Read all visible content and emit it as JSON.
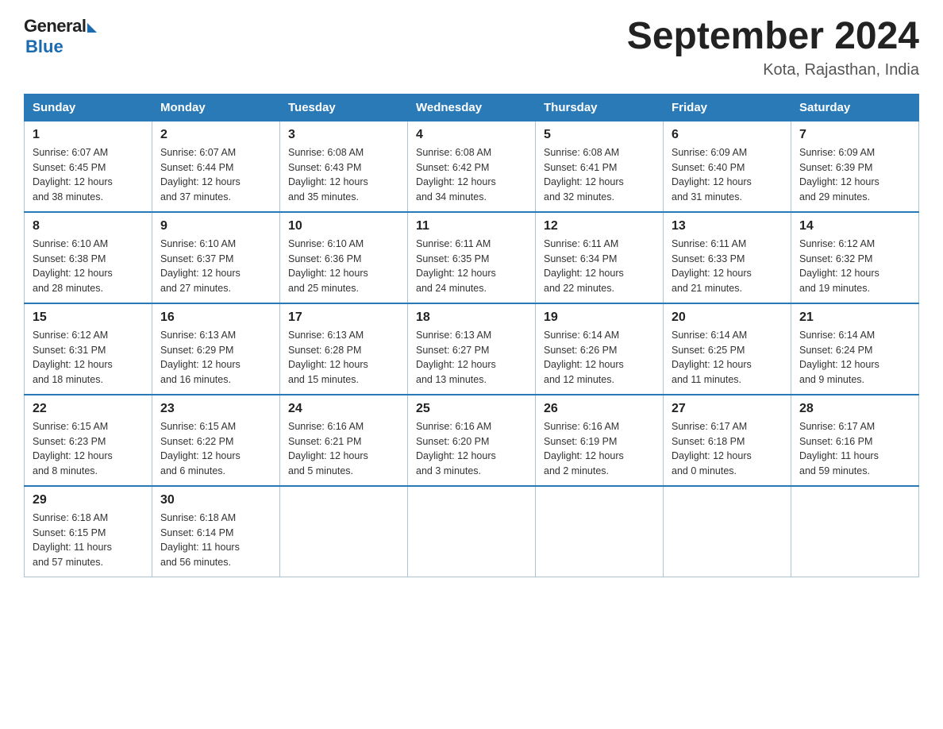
{
  "logo": {
    "general": "General",
    "blue": "Blue",
    "subtitle": "Blue"
  },
  "title": "September 2024",
  "subtitle": "Kota, Rajasthan, India",
  "days_of_week": [
    "Sunday",
    "Monday",
    "Tuesday",
    "Wednesday",
    "Thursday",
    "Friday",
    "Saturday"
  ],
  "weeks": [
    [
      {
        "num": "1",
        "info": "Sunrise: 6:07 AM\nSunset: 6:45 PM\nDaylight: 12 hours\nand 38 minutes."
      },
      {
        "num": "2",
        "info": "Sunrise: 6:07 AM\nSunset: 6:44 PM\nDaylight: 12 hours\nand 37 minutes."
      },
      {
        "num": "3",
        "info": "Sunrise: 6:08 AM\nSunset: 6:43 PM\nDaylight: 12 hours\nand 35 minutes."
      },
      {
        "num": "4",
        "info": "Sunrise: 6:08 AM\nSunset: 6:42 PM\nDaylight: 12 hours\nand 34 minutes."
      },
      {
        "num": "5",
        "info": "Sunrise: 6:08 AM\nSunset: 6:41 PM\nDaylight: 12 hours\nand 32 minutes."
      },
      {
        "num": "6",
        "info": "Sunrise: 6:09 AM\nSunset: 6:40 PM\nDaylight: 12 hours\nand 31 minutes."
      },
      {
        "num": "7",
        "info": "Sunrise: 6:09 AM\nSunset: 6:39 PM\nDaylight: 12 hours\nand 29 minutes."
      }
    ],
    [
      {
        "num": "8",
        "info": "Sunrise: 6:10 AM\nSunset: 6:38 PM\nDaylight: 12 hours\nand 28 minutes."
      },
      {
        "num": "9",
        "info": "Sunrise: 6:10 AM\nSunset: 6:37 PM\nDaylight: 12 hours\nand 27 minutes."
      },
      {
        "num": "10",
        "info": "Sunrise: 6:10 AM\nSunset: 6:36 PM\nDaylight: 12 hours\nand 25 minutes."
      },
      {
        "num": "11",
        "info": "Sunrise: 6:11 AM\nSunset: 6:35 PM\nDaylight: 12 hours\nand 24 minutes."
      },
      {
        "num": "12",
        "info": "Sunrise: 6:11 AM\nSunset: 6:34 PM\nDaylight: 12 hours\nand 22 minutes."
      },
      {
        "num": "13",
        "info": "Sunrise: 6:11 AM\nSunset: 6:33 PM\nDaylight: 12 hours\nand 21 minutes."
      },
      {
        "num": "14",
        "info": "Sunrise: 6:12 AM\nSunset: 6:32 PM\nDaylight: 12 hours\nand 19 minutes."
      }
    ],
    [
      {
        "num": "15",
        "info": "Sunrise: 6:12 AM\nSunset: 6:31 PM\nDaylight: 12 hours\nand 18 minutes."
      },
      {
        "num": "16",
        "info": "Sunrise: 6:13 AM\nSunset: 6:29 PM\nDaylight: 12 hours\nand 16 minutes."
      },
      {
        "num": "17",
        "info": "Sunrise: 6:13 AM\nSunset: 6:28 PM\nDaylight: 12 hours\nand 15 minutes."
      },
      {
        "num": "18",
        "info": "Sunrise: 6:13 AM\nSunset: 6:27 PM\nDaylight: 12 hours\nand 13 minutes."
      },
      {
        "num": "19",
        "info": "Sunrise: 6:14 AM\nSunset: 6:26 PM\nDaylight: 12 hours\nand 12 minutes."
      },
      {
        "num": "20",
        "info": "Sunrise: 6:14 AM\nSunset: 6:25 PM\nDaylight: 12 hours\nand 11 minutes."
      },
      {
        "num": "21",
        "info": "Sunrise: 6:14 AM\nSunset: 6:24 PM\nDaylight: 12 hours\nand 9 minutes."
      }
    ],
    [
      {
        "num": "22",
        "info": "Sunrise: 6:15 AM\nSunset: 6:23 PM\nDaylight: 12 hours\nand 8 minutes."
      },
      {
        "num": "23",
        "info": "Sunrise: 6:15 AM\nSunset: 6:22 PM\nDaylight: 12 hours\nand 6 minutes."
      },
      {
        "num": "24",
        "info": "Sunrise: 6:16 AM\nSunset: 6:21 PM\nDaylight: 12 hours\nand 5 minutes."
      },
      {
        "num": "25",
        "info": "Sunrise: 6:16 AM\nSunset: 6:20 PM\nDaylight: 12 hours\nand 3 minutes."
      },
      {
        "num": "26",
        "info": "Sunrise: 6:16 AM\nSunset: 6:19 PM\nDaylight: 12 hours\nand 2 minutes."
      },
      {
        "num": "27",
        "info": "Sunrise: 6:17 AM\nSunset: 6:18 PM\nDaylight: 12 hours\nand 0 minutes."
      },
      {
        "num": "28",
        "info": "Sunrise: 6:17 AM\nSunset: 6:16 PM\nDaylight: 11 hours\nand 59 minutes."
      }
    ],
    [
      {
        "num": "29",
        "info": "Sunrise: 6:18 AM\nSunset: 6:15 PM\nDaylight: 11 hours\nand 57 minutes."
      },
      {
        "num": "30",
        "info": "Sunrise: 6:18 AM\nSunset: 6:14 PM\nDaylight: 11 hours\nand 56 minutes."
      },
      {
        "num": "",
        "info": ""
      },
      {
        "num": "",
        "info": ""
      },
      {
        "num": "",
        "info": ""
      },
      {
        "num": "",
        "info": ""
      },
      {
        "num": "",
        "info": ""
      }
    ]
  ]
}
